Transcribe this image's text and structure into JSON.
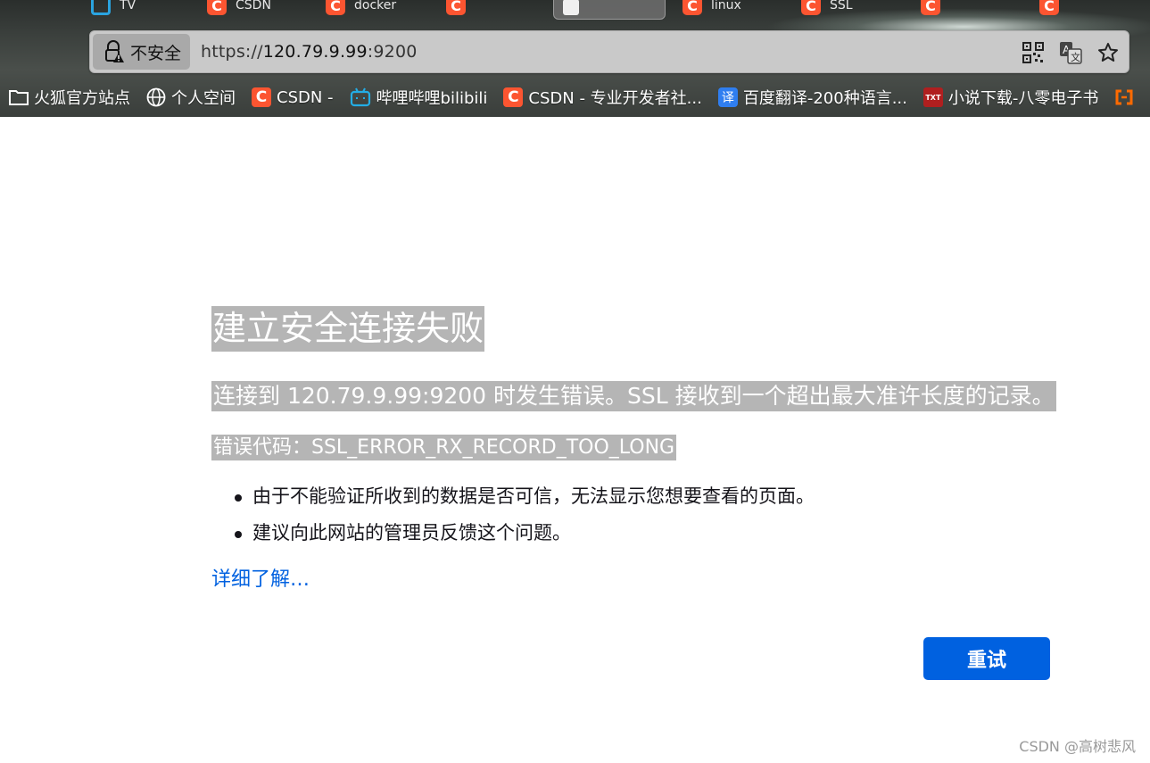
{
  "tabs": [
    {
      "label": "",
      "icon": "none"
    },
    {
      "label": "TV",
      "icon": "tv-icon"
    },
    {
      "label": "CSDN",
      "icon": "csdn-icon"
    },
    {
      "label": "docker",
      "icon": "csdn-icon"
    },
    {
      "label": "",
      "icon": "csdn-icon"
    },
    {
      "label": "",
      "icon": "lock-icon",
      "active": true
    },
    {
      "label": "linux",
      "icon": "csdn-icon"
    },
    {
      "label": "SSL",
      "icon": "csdn-icon"
    },
    {
      "label": "",
      "icon": "csdn-icon"
    },
    {
      "label": "",
      "icon": "csdn-icon"
    }
  ],
  "url_bar": {
    "security_label": "不安全",
    "scheme": "https://",
    "host": "120.79.9.99",
    "port": ":9200"
  },
  "bookmarks": [
    {
      "label": "火狐官方站点",
      "icon": "folder-icon"
    },
    {
      "label": "个人空间",
      "icon": "globe-icon"
    },
    {
      "label": "CSDN -",
      "icon": "csdn-icon"
    },
    {
      "label": "哔哩哔哩bilibili",
      "icon": "bilibili-icon"
    },
    {
      "label": "CSDN - 专业开发者社...",
      "icon": "csdn-icon"
    },
    {
      "label": "百度翻译-200种语言...",
      "icon": "translate-icon"
    },
    {
      "label": "小说下载-八零电子书",
      "icon": "txt-icon"
    }
  ],
  "error": {
    "title": "建立安全连接失败",
    "description": "连接到 120.79.9.99:9200 时发生错误。SSL 接收到一个超出最大准许长度的记录。",
    "code": "错误代码：SSL_ERROR_RX_RECORD_TOO_LONG",
    "items": [
      "由于不能验证所收到的数据是否可信，无法显示您想要查看的页面。",
      "建议向此网站的管理员反馈这个问题。"
    ],
    "learn_more": "详细了解…",
    "retry_label": "重试"
  },
  "watermark": "CSDN @高树悲风",
  "colors": {
    "accent": "#0061e0",
    "highlight": "#b5b5b5",
    "csdn": "#fc5531"
  }
}
